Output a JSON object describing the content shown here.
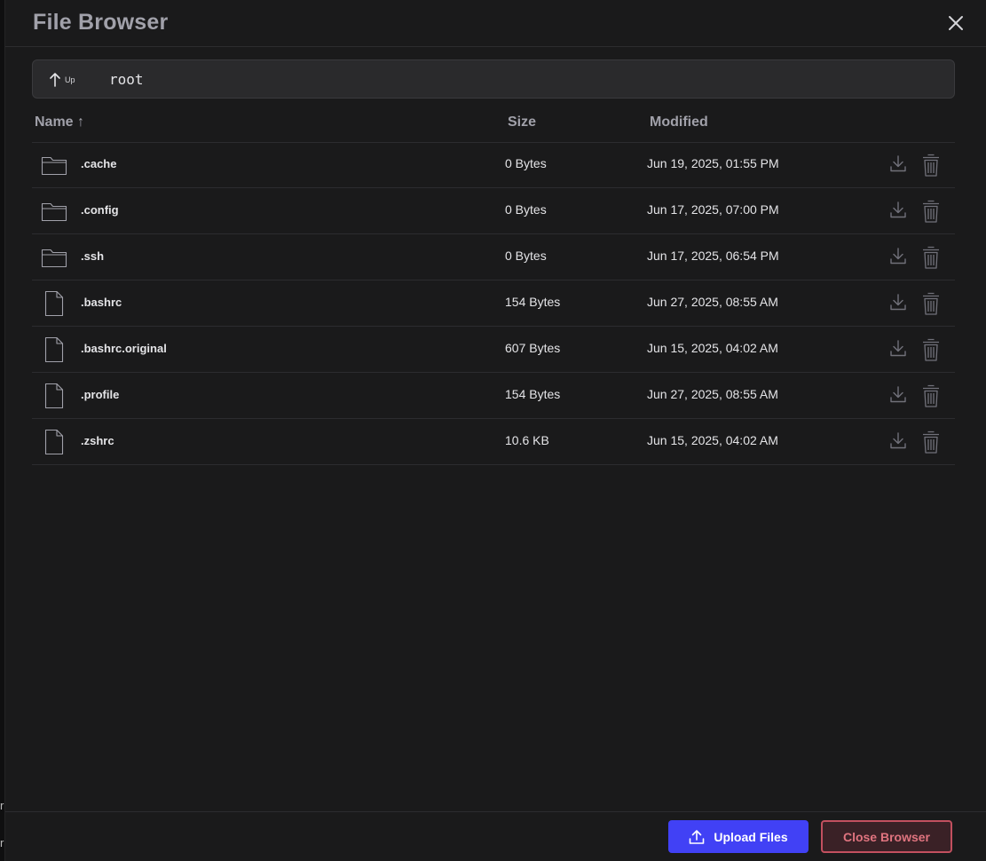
{
  "window": {
    "title": "File Browser"
  },
  "path_bar": {
    "up_label": "Up",
    "current_path": "root"
  },
  "table": {
    "columns": {
      "name": "Name ↑",
      "size": "Size",
      "modified": "Modified"
    },
    "rows": [
      {
        "type": "folder",
        "name": ".cache",
        "size": "0 Bytes",
        "modified": "Jun 19, 2025, 01:55 PM"
      },
      {
        "type": "folder",
        "name": ".config",
        "size": "0 Bytes",
        "modified": "Jun 17, 2025, 07:00 PM"
      },
      {
        "type": "folder",
        "name": ".ssh",
        "size": "0 Bytes",
        "modified": "Jun 17, 2025, 06:54 PM"
      },
      {
        "type": "file",
        "name": ".bashrc",
        "size": "154 Bytes",
        "modified": "Jun 27, 2025, 08:55 AM"
      },
      {
        "type": "file",
        "name": ".bashrc.original",
        "size": "607 Bytes",
        "modified": "Jun 15, 2025, 04:02 AM"
      },
      {
        "type": "file",
        "name": ".profile",
        "size": "154 Bytes",
        "modified": "Jun 27, 2025, 08:55 AM"
      },
      {
        "type": "file",
        "name": ".zshrc",
        "size": "10.6 KB",
        "modified": "Jun 15, 2025, 04:02 AM"
      }
    ]
  },
  "footer": {
    "upload_label": "Upload Files",
    "close_label": "Close Browser"
  },
  "colors": {
    "accent": "#4141f5",
    "danger": "#c2505f",
    "background": "#1a1a1b"
  }
}
